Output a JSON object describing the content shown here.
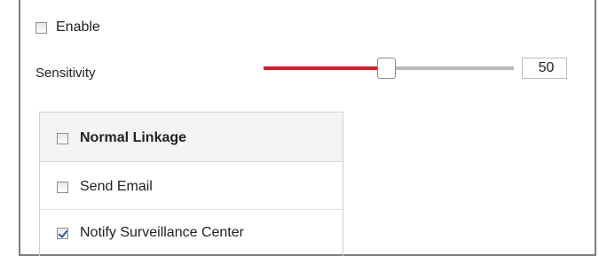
{
  "enable": {
    "label": "Enable",
    "checked": false
  },
  "sensitivity": {
    "label": "Sensitivity",
    "value": "50",
    "level_fraction": 0.5,
    "fill_color": "#cc1f2b"
  },
  "linkage": {
    "header": {
      "label": "Normal Linkage",
      "checked": false
    },
    "items": [
      {
        "label": "Send Email",
        "checked": false
      },
      {
        "label": "Notify Surveillance Center",
        "checked": true
      }
    ]
  }
}
